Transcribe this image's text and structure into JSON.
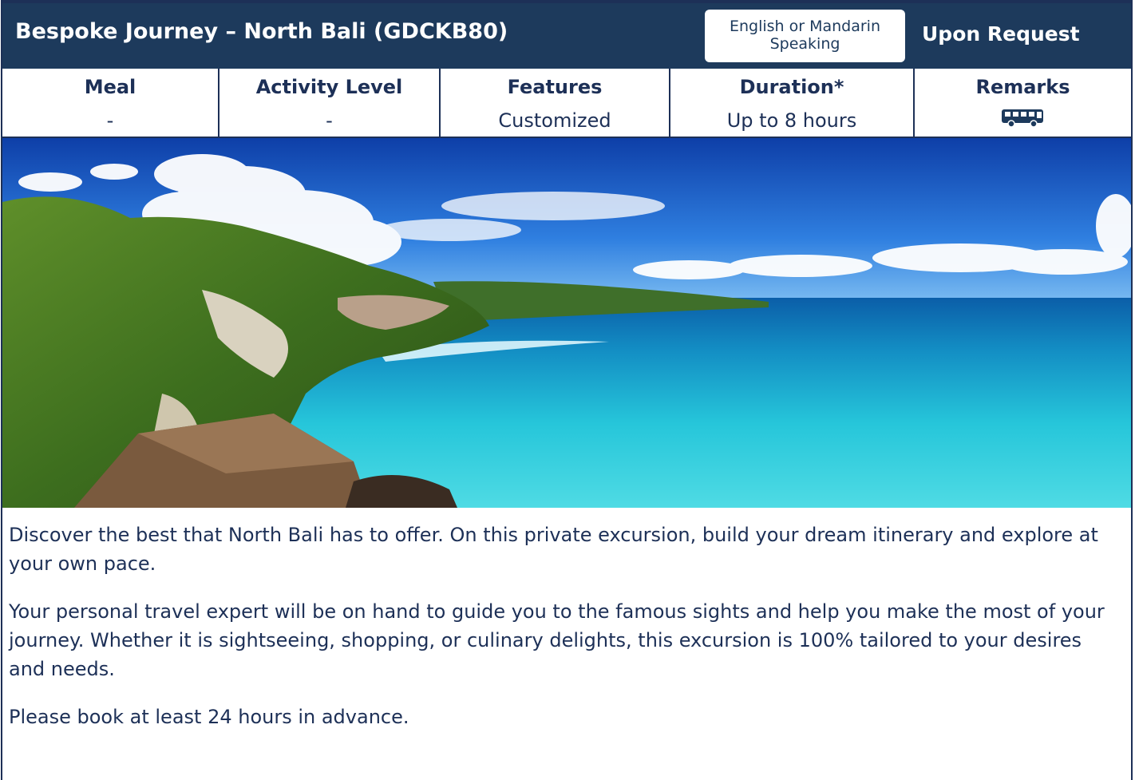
{
  "header": {
    "title": "Bespoke Journey – North Bali (GDCKB80)",
    "language_line1": "English or Mandarin",
    "language_line2": "Speaking",
    "availability": "Upon Request"
  },
  "info_table": [
    {
      "label": "Meal",
      "value": "-"
    },
    {
      "label": "Activity Level",
      "value": "-"
    },
    {
      "label": "Features",
      "value": "Customized"
    },
    {
      "label": "Duration*",
      "value": "Up to 8 hours"
    },
    {
      "label": "Remarks",
      "icon": "coach-bus-icon"
    }
  ],
  "photo": {
    "subject": "north-bali-coastline-photo"
  },
  "description": [
    "Discover the best that North Bali has to offer. On this private excursion, build your dream itinerary and explore at your own pace.",
    "Your personal travel expert will be on hand to guide you to the famous sights and help you make the most of your journey. Whether it is sightseeing, shopping, or culinary delights, this excursion is 100% tailored to your desires and needs.",
    "Please book at least 24 hours in advance."
  ],
  "colors": {
    "navy": "#1d3a5c",
    "text": "#1d3057",
    "sea": "#26c6da",
    "sky": "#1f66c9"
  }
}
